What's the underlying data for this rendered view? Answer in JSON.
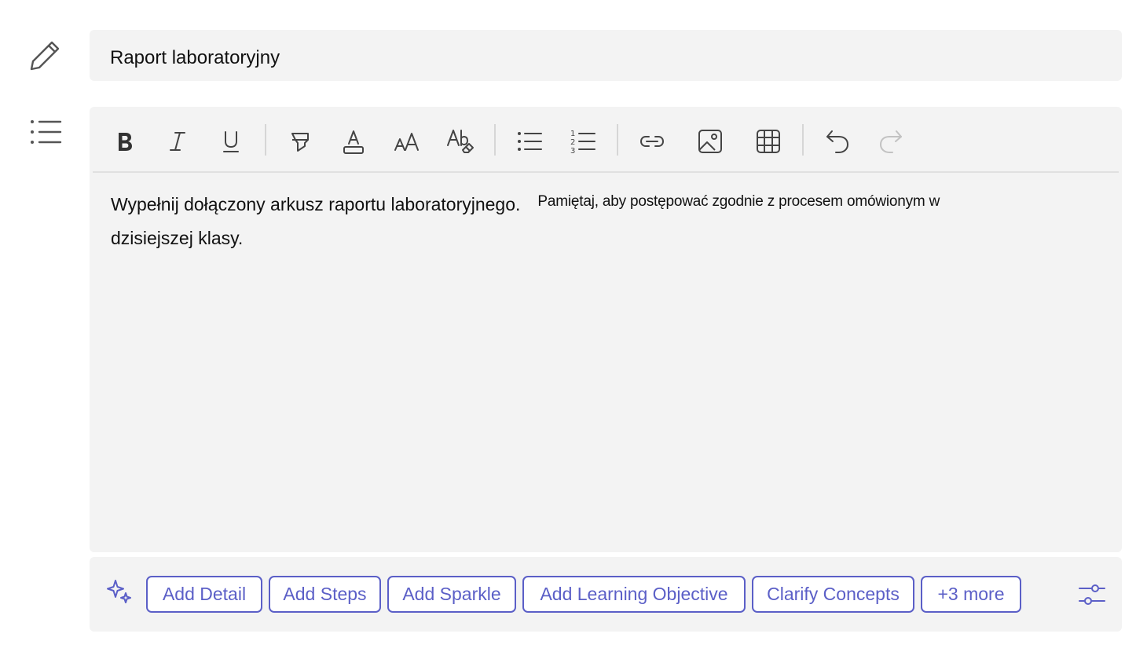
{
  "side": {
    "title_icon": "pencil-icon",
    "description_icon": "bulleted-list-icon"
  },
  "title": {
    "value": "Raport laboratoryjny"
  },
  "toolbar": {
    "buttons": [
      "bold",
      "italic",
      "underline",
      "highlight",
      "font-color",
      "font-size",
      "clear-formatting",
      "bulleted-list",
      "numbered-list",
      "link",
      "image",
      "table",
      "undo",
      "redo"
    ],
    "redo_enabled": false
  },
  "editor": {
    "text_part1": "Wypełnij dołączony arkusz raportu laboratoryjnego.",
    "text_part2": "Pamiętaj, aby postępować zgodnie z procesem omówionym w",
    "text_line2": "dzisiejszej klasy."
  },
  "suggestions": {
    "icon": "sparkle-icon",
    "chips": [
      "Add Detail",
      "Add Steps",
      "Add Sparkle",
      "Add Learning Objective",
      "Clarify Concepts",
      "+3 more"
    ],
    "settings_icon": "sliders-icon"
  },
  "colors": {
    "accent": "#5b5fc7",
    "panel_bg": "#f3f3f3",
    "icon": "#424242",
    "disabled_icon": "#c2c2c2"
  }
}
